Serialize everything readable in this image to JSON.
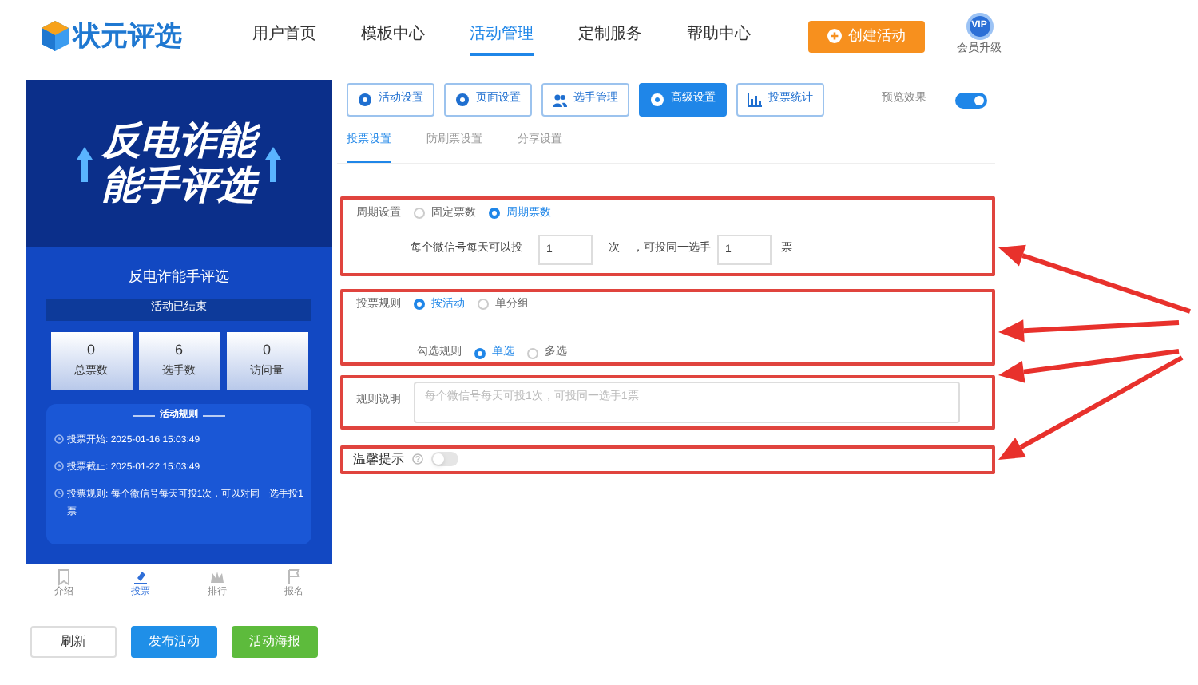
{
  "header": {
    "logo": "状元评选",
    "nav": [
      {
        "label": "用户首页",
        "selected": false
      },
      {
        "label": "模板中心",
        "selected": false
      },
      {
        "label": "活动管理",
        "selected": true
      },
      {
        "label": "定制服务",
        "selected": false
      },
      {
        "label": "帮助中心",
        "selected": false
      }
    ],
    "create_button": "创建活动",
    "vip_badge": "VIP",
    "vip_label": "会员升级"
  },
  "preview": {
    "banner_lines": [
      "反电诈能",
      "能手评选"
    ],
    "title": "反电诈能手评选",
    "status": "活动已结束",
    "stats": [
      {
        "value": "0",
        "label": "总票数"
      },
      {
        "value": "6",
        "label": "选手数"
      },
      {
        "value": "0",
        "label": "访问量"
      }
    ],
    "rules_heading": "活动规则",
    "rules": [
      {
        "label": "投票开始:",
        "value": "2025-01-16 15:03:49"
      },
      {
        "label": "投票截止:",
        "value": "2025-01-22 15:03:49"
      },
      {
        "label": "投票规则:",
        "value": "每个微信号每天可投1次，可以对同一选手投1票"
      }
    ],
    "bottom_nav": [
      {
        "label": "介绍",
        "selected": false
      },
      {
        "label": "投票",
        "selected": true
      },
      {
        "label": "排行",
        "selected": false
      },
      {
        "label": "报名",
        "selected": false
      }
    ],
    "buttons": [
      {
        "label": "刷新",
        "kind": "outline"
      },
      {
        "label": "发布活动",
        "kind": "primary"
      },
      {
        "label": "活动海报",
        "kind": "success"
      }
    ]
  },
  "toolbar": {
    "buttons": [
      {
        "label": "活动设置",
        "selected": false
      },
      {
        "label": "页面设置",
        "selected": false
      },
      {
        "label": "选手管理",
        "selected": false
      },
      {
        "label": "高级设置",
        "selected": true
      },
      {
        "label": "投票统计",
        "selected": false
      }
    ],
    "preview_label": "预览效果",
    "preview_on": true
  },
  "subtabs": [
    {
      "label": "投票设置",
      "selected": true
    },
    {
      "label": "防刷票设置",
      "selected": false
    },
    {
      "label": "分享设置",
      "selected": false
    }
  ],
  "period": {
    "label": "周期设置",
    "options": [
      {
        "label": "固定票数",
        "selected": false
      },
      {
        "label": "周期票数",
        "selected": true
      }
    ],
    "prefix": "每个微信号每天可以投",
    "times": "1",
    "times_unit": "次",
    "middle": "，可投同一选手",
    "votes": "1",
    "votes_unit": "票"
  },
  "vote_rule": {
    "label": "投票规则",
    "options": [
      {
        "label": "按活动",
        "selected": true
      },
      {
        "label": "单分组",
        "selected": false
      }
    ],
    "select_label": "勾选规则",
    "select_options": [
      {
        "label": "单选",
        "selected": true
      },
      {
        "label": "多选",
        "selected": false
      }
    ]
  },
  "rule_desc": {
    "label": "规则说明",
    "placeholder": "每个微信号每天可投1次，可投同一选手1票"
  },
  "tip": {
    "label": "温馨提示",
    "on": false
  }
}
